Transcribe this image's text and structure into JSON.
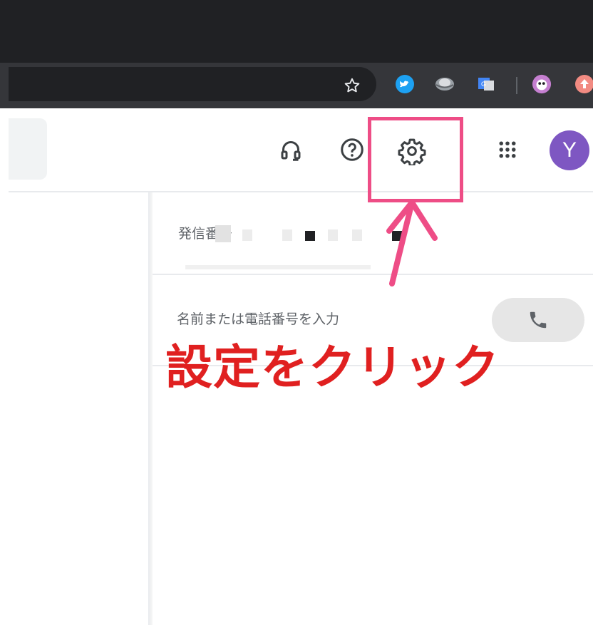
{
  "browser": {
    "icons": [
      "star-icon",
      "twitter-extension-icon",
      "globe-extension-icon",
      "translate-extension-icon",
      "owl-extension-icon",
      "upload-extension-icon"
    ]
  },
  "header": {
    "icons": [
      "headset-icon",
      "help-icon",
      "settings-icon",
      "apps-grid-icon"
    ],
    "avatar_initial": "Y",
    "avatar_color": "#7e57c2"
  },
  "dial": {
    "caller_id_label": "発信番号",
    "number_placeholder": "名前または電話番号を入力",
    "call_icon": "phone-icon"
  },
  "annotation": {
    "text": "設定をクリック",
    "highlight_color": "#ee4d86",
    "text_color": "#e02020"
  }
}
